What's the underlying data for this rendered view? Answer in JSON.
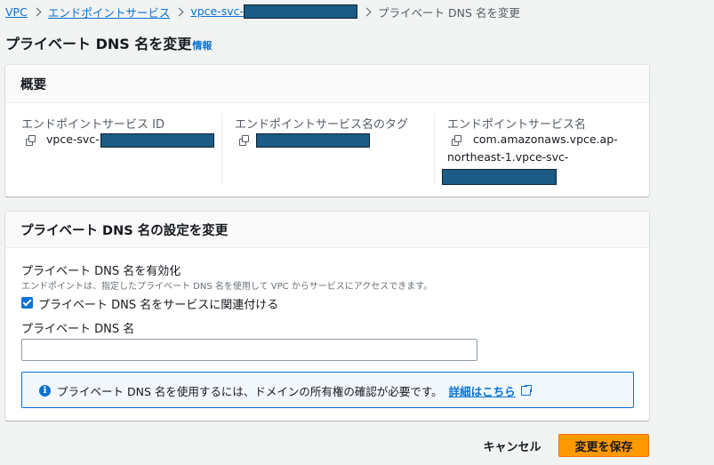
{
  "breadcrumb": {
    "items": [
      "VPC",
      "エンドポイントサービス",
      "vpce-svc-"
    ],
    "current": "プライベート DNS 名を変更"
  },
  "page": {
    "title": "プライベート DNS 名を変更",
    "info_link": "情報"
  },
  "overview": {
    "title": "概要",
    "columns": [
      {
        "label": "エンドポイントサービス ID",
        "value": "vpce-svc-"
      },
      {
        "label": "エンドポイントサービス名のタグ",
        "value": ""
      },
      {
        "label": "エンドポイントサービス名",
        "value_line1": "com.amazonaws.vpce.ap-",
        "value_line2": "northeast-1.vpce-svc-"
      }
    ]
  },
  "dns_settings": {
    "title": "プライベート DNS 名の設定を変更",
    "enable_label": "プライベート DNS 名を有効化",
    "enable_description": "エンドポイントは、指定したプライベート DNS 名を使用して VPC からサービスにアクセスできます。",
    "checkbox_label": "プライベート DNS 名をサービスに関連付ける",
    "checkbox_checked": true,
    "dns_name_label": "プライベート DNS 名",
    "dns_name_value": "",
    "alert_text": "プライベート DNS 名を使用するには、ドメインの所有権の確認が必要です。",
    "alert_link": "詳細はこちら"
  },
  "actions": {
    "cancel": "キャンセル",
    "save": "変更を保存"
  },
  "colors": {
    "link": "#0972d3",
    "primary_button": "#ff9900",
    "redaction": "#1b5b85"
  }
}
